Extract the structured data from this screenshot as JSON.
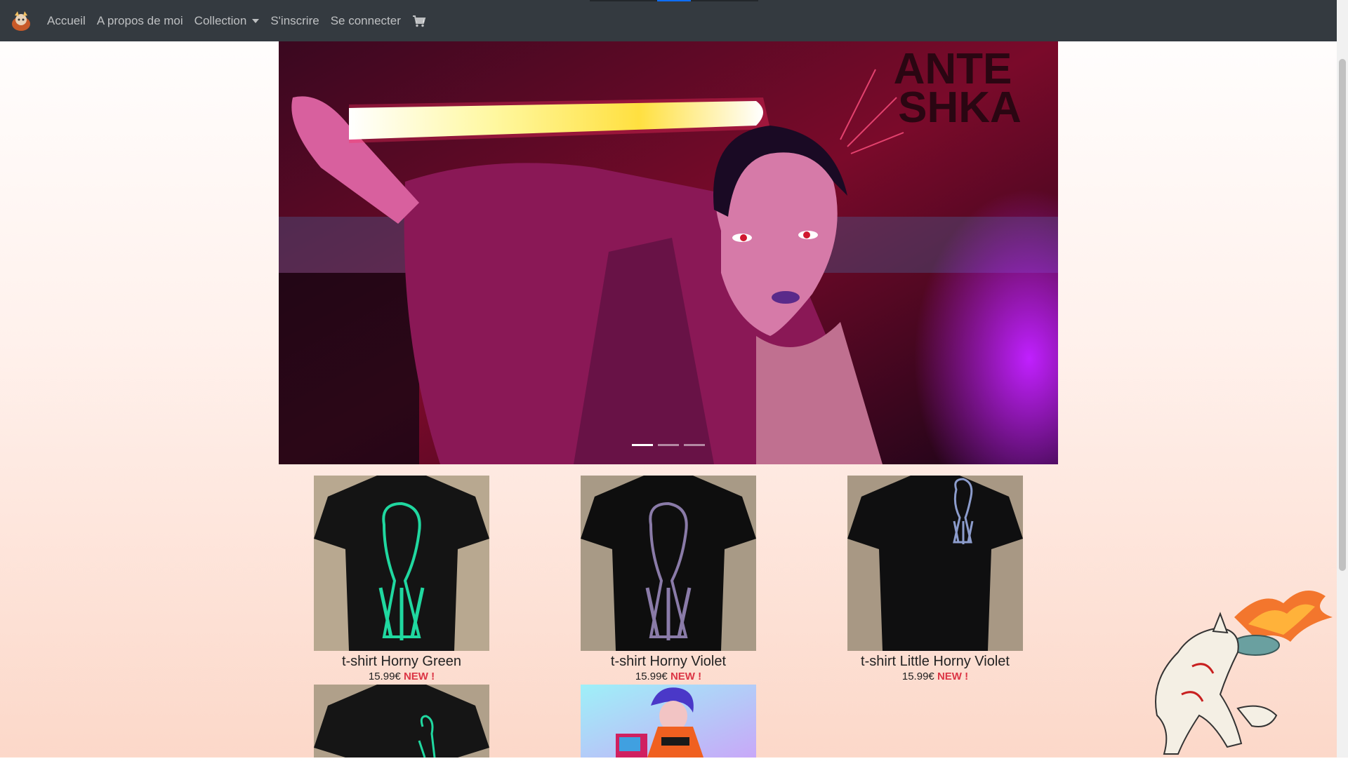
{
  "nav": {
    "items": [
      {
        "label": "Accueil"
      },
      {
        "label": "A propos de moi"
      },
      {
        "label": "Collection"
      },
      {
        "label": "S'inscrire"
      },
      {
        "label": "Se connecter"
      }
    ],
    "icons": [
      "logo-icon",
      "caret-down-icon",
      "cart-icon"
    ]
  },
  "carousel": {
    "banner_text": [
      "ANTE",
      "SHKA"
    ],
    "slides_count": 3,
    "active_slide": 1
  },
  "products": [
    {
      "name": "t-shirt Horny Green",
      "price": "15.99€",
      "badge": "NEW !",
      "print_color": "#20d8a0"
    },
    {
      "name": "t-shirt Horny Violet",
      "price": "15.99€",
      "badge": "NEW !",
      "print_color": "#8a7ba8"
    },
    {
      "name": "t-shirt Little Horny Violet",
      "price": "15.99€",
      "badge": "NEW !",
      "print_color": "#8c9ccc"
    }
  ],
  "colors": {
    "navbar": "#343a40",
    "badge_new": "#dc3545"
  }
}
